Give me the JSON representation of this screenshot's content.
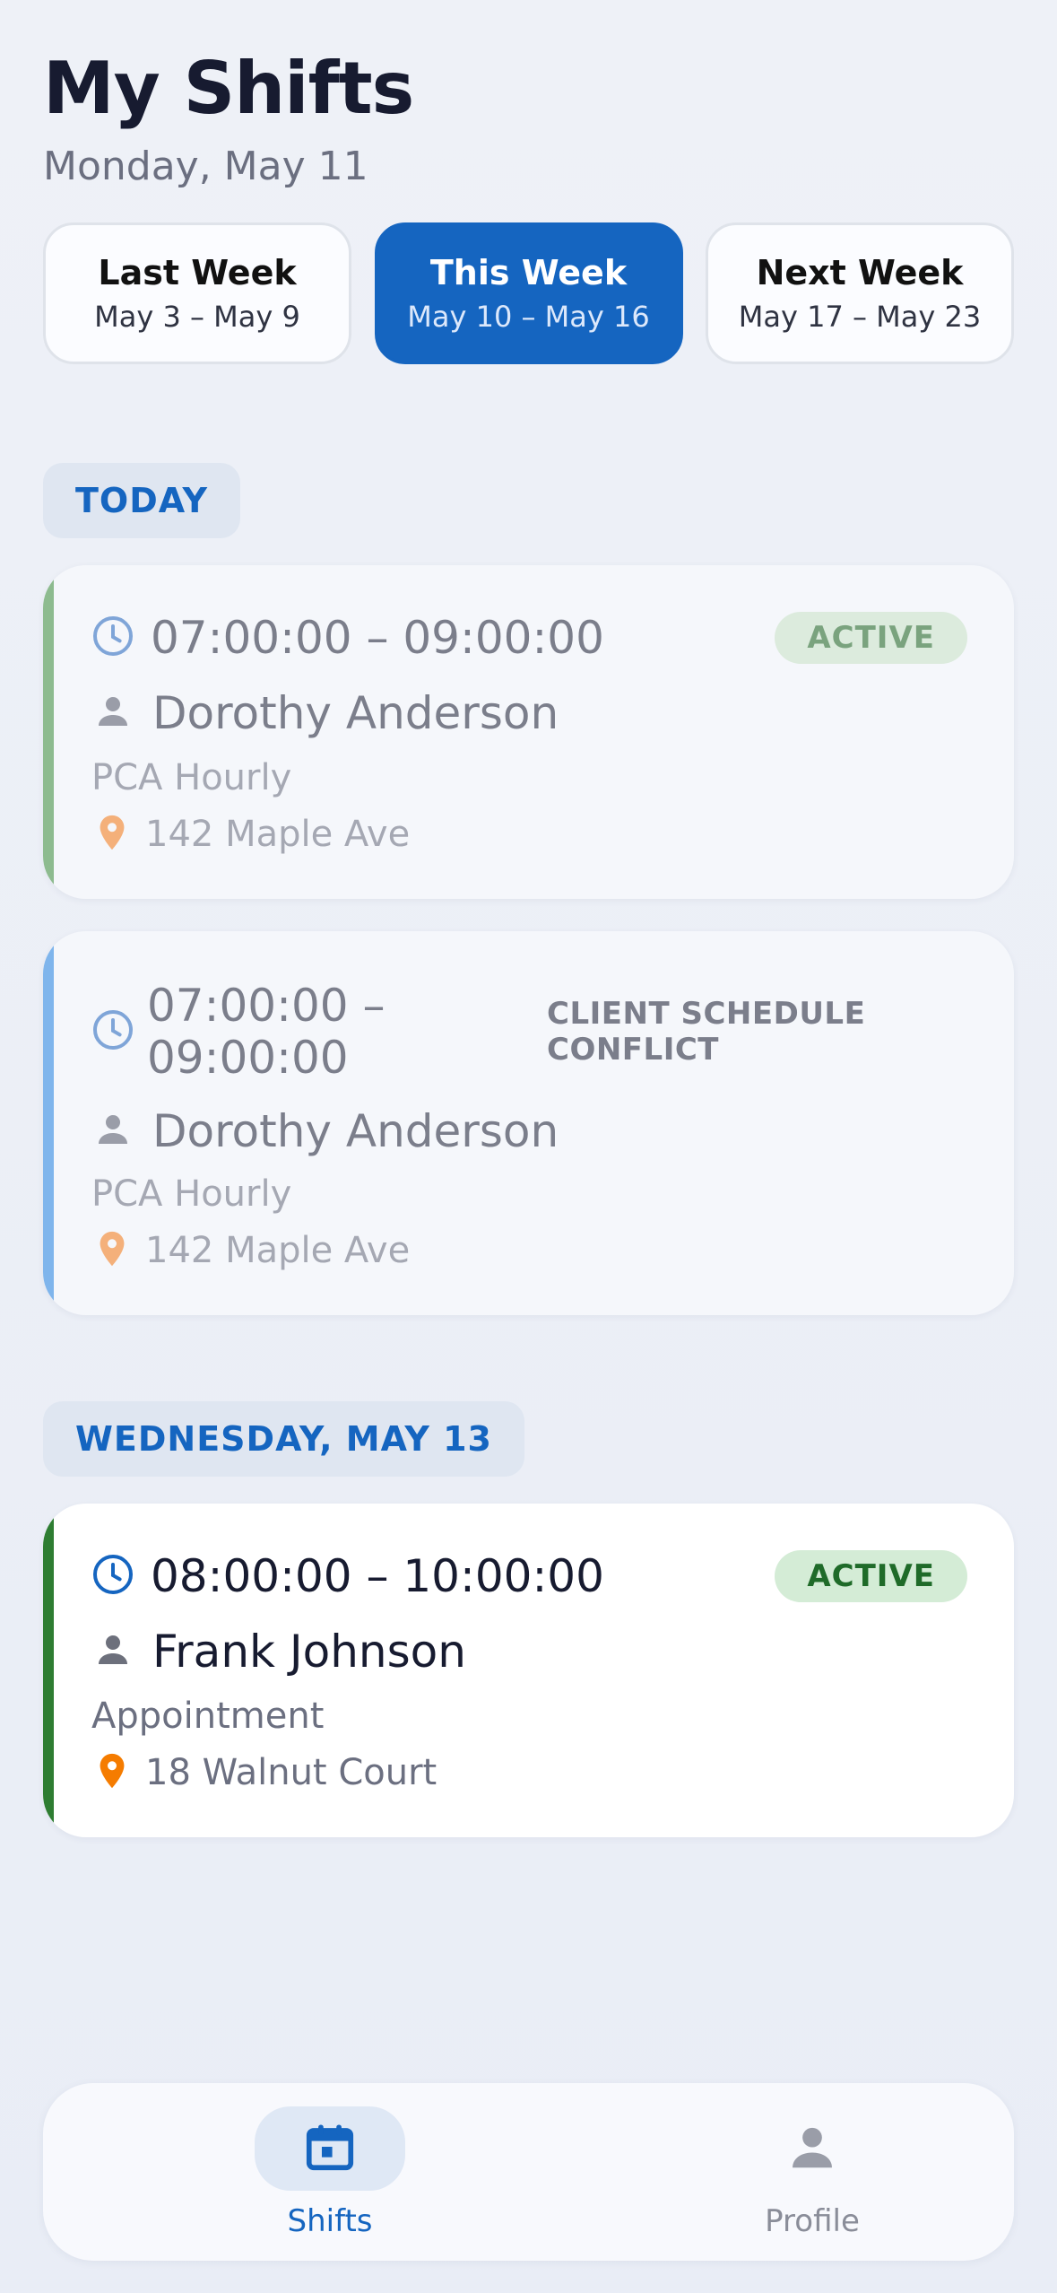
{
  "header": {
    "title": "My Shifts",
    "date": "Monday, May 11"
  },
  "week_tabs": [
    {
      "label": "Last Week",
      "range": "May 3 – May 9",
      "selected": false
    },
    {
      "label": "This Week",
      "range": "May 10 – May 16",
      "selected": true
    },
    {
      "label": "Next Week",
      "range": "May 17 – May 23",
      "selected": false
    }
  ],
  "sections": [
    {
      "heading": "TODAY",
      "shifts": [
        {
          "time": "07:00:00 – 09:00:00",
          "status": "ACTIVE",
          "client": "Dorothy Anderson",
          "service": "PCA Hourly",
          "address": "142 Maple Ave",
          "accent_color": "#8dbb8f"
        },
        {
          "time_line1": "07:00:00 –",
          "time_line2": "09:00:00",
          "status_line1": "CLIENT SCHEDULE",
          "status_line2": "CONFLICT",
          "client": "Dorothy Anderson",
          "service": "PCA Hourly",
          "address": "142 Maple Ave",
          "accent_color": "#7fb5ec"
        }
      ]
    },
    {
      "heading": "WEDNESDAY, MAY 13",
      "shifts": [
        {
          "time": "08:00:00 – 10:00:00",
          "status": "ACTIVE",
          "client": "Frank Johnson",
          "service": "Appointment",
          "address": "18 Walnut Court",
          "accent_color": "#2e7d32"
        }
      ]
    }
  ],
  "bottom_nav": [
    {
      "label": "Shifts",
      "icon": "calendar-icon",
      "selected": true
    },
    {
      "label": "Profile",
      "icon": "person-icon",
      "selected": false
    }
  ],
  "colors": {
    "primary": "#1565c0",
    "active_text": "#1f6b29",
    "active_bg": "#d4ecd6",
    "pin": "#f57c00"
  }
}
